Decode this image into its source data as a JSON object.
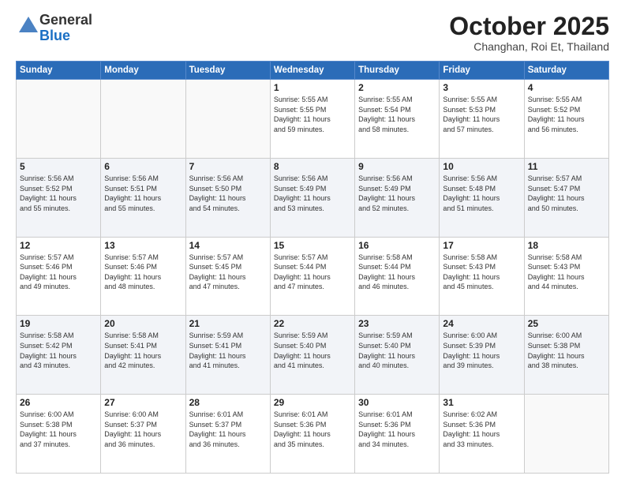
{
  "logo": {
    "general": "General",
    "blue": "Blue"
  },
  "header": {
    "month": "October 2025",
    "location": "Changhan, Roi Et, Thailand"
  },
  "weekdays": [
    "Sunday",
    "Monday",
    "Tuesday",
    "Wednesday",
    "Thursday",
    "Friday",
    "Saturday"
  ],
  "weeks": [
    [
      {
        "day": "",
        "info": ""
      },
      {
        "day": "",
        "info": ""
      },
      {
        "day": "",
        "info": ""
      },
      {
        "day": "1",
        "info": "Sunrise: 5:55 AM\nSunset: 5:55 PM\nDaylight: 11 hours\nand 59 minutes."
      },
      {
        "day": "2",
        "info": "Sunrise: 5:55 AM\nSunset: 5:54 PM\nDaylight: 11 hours\nand 58 minutes."
      },
      {
        "day": "3",
        "info": "Sunrise: 5:55 AM\nSunset: 5:53 PM\nDaylight: 11 hours\nand 57 minutes."
      },
      {
        "day": "4",
        "info": "Sunrise: 5:55 AM\nSunset: 5:52 PM\nDaylight: 11 hours\nand 56 minutes."
      }
    ],
    [
      {
        "day": "5",
        "info": "Sunrise: 5:56 AM\nSunset: 5:52 PM\nDaylight: 11 hours\nand 55 minutes."
      },
      {
        "day": "6",
        "info": "Sunrise: 5:56 AM\nSunset: 5:51 PM\nDaylight: 11 hours\nand 55 minutes."
      },
      {
        "day": "7",
        "info": "Sunrise: 5:56 AM\nSunset: 5:50 PM\nDaylight: 11 hours\nand 54 minutes."
      },
      {
        "day": "8",
        "info": "Sunrise: 5:56 AM\nSunset: 5:49 PM\nDaylight: 11 hours\nand 53 minutes."
      },
      {
        "day": "9",
        "info": "Sunrise: 5:56 AM\nSunset: 5:49 PM\nDaylight: 11 hours\nand 52 minutes."
      },
      {
        "day": "10",
        "info": "Sunrise: 5:56 AM\nSunset: 5:48 PM\nDaylight: 11 hours\nand 51 minutes."
      },
      {
        "day": "11",
        "info": "Sunrise: 5:57 AM\nSunset: 5:47 PM\nDaylight: 11 hours\nand 50 minutes."
      }
    ],
    [
      {
        "day": "12",
        "info": "Sunrise: 5:57 AM\nSunset: 5:46 PM\nDaylight: 11 hours\nand 49 minutes."
      },
      {
        "day": "13",
        "info": "Sunrise: 5:57 AM\nSunset: 5:46 PM\nDaylight: 11 hours\nand 48 minutes."
      },
      {
        "day": "14",
        "info": "Sunrise: 5:57 AM\nSunset: 5:45 PM\nDaylight: 11 hours\nand 47 minutes."
      },
      {
        "day": "15",
        "info": "Sunrise: 5:57 AM\nSunset: 5:44 PM\nDaylight: 11 hours\nand 47 minutes."
      },
      {
        "day": "16",
        "info": "Sunrise: 5:58 AM\nSunset: 5:44 PM\nDaylight: 11 hours\nand 46 minutes."
      },
      {
        "day": "17",
        "info": "Sunrise: 5:58 AM\nSunset: 5:43 PM\nDaylight: 11 hours\nand 45 minutes."
      },
      {
        "day": "18",
        "info": "Sunrise: 5:58 AM\nSunset: 5:43 PM\nDaylight: 11 hours\nand 44 minutes."
      }
    ],
    [
      {
        "day": "19",
        "info": "Sunrise: 5:58 AM\nSunset: 5:42 PM\nDaylight: 11 hours\nand 43 minutes."
      },
      {
        "day": "20",
        "info": "Sunrise: 5:58 AM\nSunset: 5:41 PM\nDaylight: 11 hours\nand 42 minutes."
      },
      {
        "day": "21",
        "info": "Sunrise: 5:59 AM\nSunset: 5:41 PM\nDaylight: 11 hours\nand 41 minutes."
      },
      {
        "day": "22",
        "info": "Sunrise: 5:59 AM\nSunset: 5:40 PM\nDaylight: 11 hours\nand 41 minutes."
      },
      {
        "day": "23",
        "info": "Sunrise: 5:59 AM\nSunset: 5:40 PM\nDaylight: 11 hours\nand 40 minutes."
      },
      {
        "day": "24",
        "info": "Sunrise: 6:00 AM\nSunset: 5:39 PM\nDaylight: 11 hours\nand 39 minutes."
      },
      {
        "day": "25",
        "info": "Sunrise: 6:00 AM\nSunset: 5:38 PM\nDaylight: 11 hours\nand 38 minutes."
      }
    ],
    [
      {
        "day": "26",
        "info": "Sunrise: 6:00 AM\nSunset: 5:38 PM\nDaylight: 11 hours\nand 37 minutes."
      },
      {
        "day": "27",
        "info": "Sunrise: 6:00 AM\nSunset: 5:37 PM\nDaylight: 11 hours\nand 36 minutes."
      },
      {
        "day": "28",
        "info": "Sunrise: 6:01 AM\nSunset: 5:37 PM\nDaylight: 11 hours\nand 36 minutes."
      },
      {
        "day": "29",
        "info": "Sunrise: 6:01 AM\nSunset: 5:36 PM\nDaylight: 11 hours\nand 35 minutes."
      },
      {
        "day": "30",
        "info": "Sunrise: 6:01 AM\nSunset: 5:36 PM\nDaylight: 11 hours\nand 34 minutes."
      },
      {
        "day": "31",
        "info": "Sunrise: 6:02 AM\nSunset: 5:36 PM\nDaylight: 11 hours\nand 33 minutes."
      },
      {
        "day": "",
        "info": ""
      }
    ]
  ]
}
